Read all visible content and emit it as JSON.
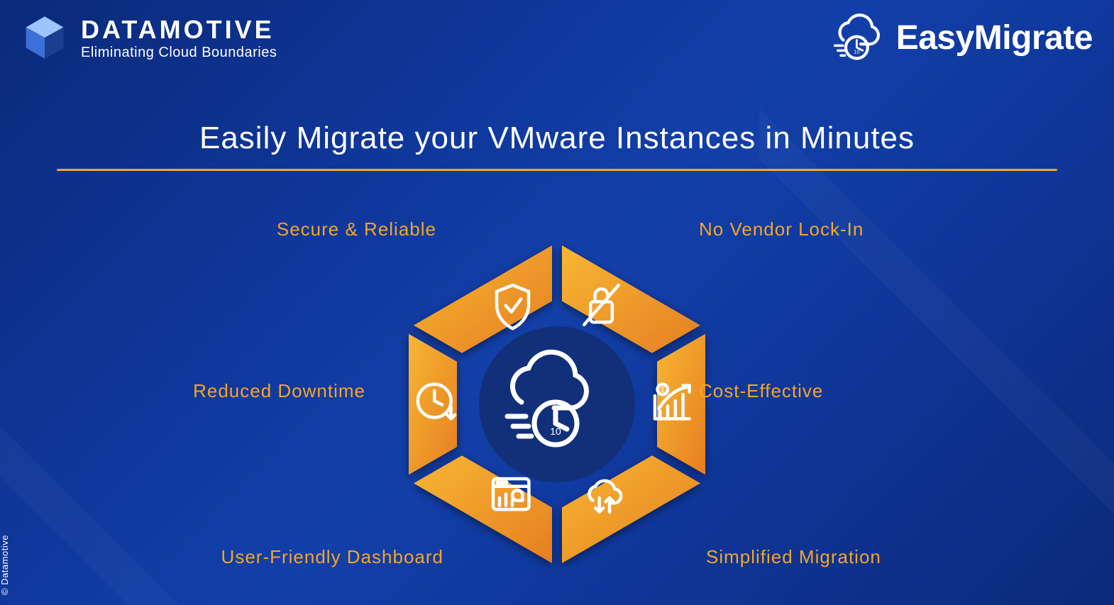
{
  "brand": {
    "name": "DATAMOTIVE",
    "tagline": "Eliminating Cloud Boundaries"
  },
  "product": {
    "name": "EasyMigrate"
  },
  "headline": "Easily Migrate your VMware Instances in Minutes",
  "features": {
    "top_left": {
      "label": "Secure & Reliable",
      "icon": "shield-check-icon"
    },
    "top_right": {
      "label": "No Vendor Lock-In",
      "icon": "unlocked-icon"
    },
    "mid_left": {
      "label": "Reduced Downtime",
      "icon": "clock-down-icon"
    },
    "mid_right": {
      "label": "Cost-Effective",
      "icon": "cost-chart-icon"
    },
    "bottom_left": {
      "label": "User-Friendly Dashboard",
      "icon": "dashboard-icon"
    },
    "bottom_right": {
      "label": "Simplified Migration",
      "icon": "cloud-arrows-icon"
    }
  },
  "center_icon": "cloud-stopwatch-icon",
  "colors": {
    "accent": "#f5a623",
    "wedge": "#f39c12",
    "bg_dark": "#0f3699"
  },
  "copyright": "© Datamotive"
}
